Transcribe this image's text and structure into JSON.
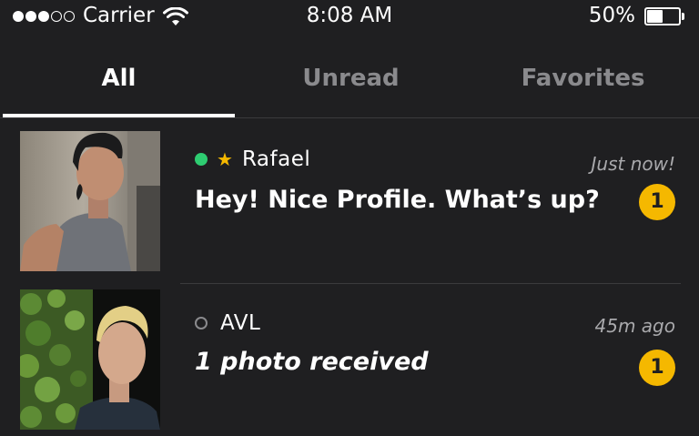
{
  "status_bar": {
    "carrier": "Carrier",
    "time": "8:08 AM",
    "battery_percent": "50%",
    "battery_level": 0.5,
    "signal_bars_filled": 3,
    "signal_bars_total": 5
  },
  "tabs": [
    {
      "label": "All",
      "active": true
    },
    {
      "label": "Unread",
      "active": false
    },
    {
      "label": "Favorites",
      "active": false
    }
  ],
  "conversations": [
    {
      "name": "Rafael",
      "online": true,
      "favorite": true,
      "timestamp": "Just now!",
      "message": "Hey! Nice Profile. What’s up?",
      "unread_count": "1"
    },
    {
      "name": "AVL",
      "online": false,
      "favorite": false,
      "timestamp": "45m ago",
      "message": "1 photo received",
      "unread_count": "1"
    }
  ],
  "colors": {
    "background": "#1f1f21",
    "accent": "#f5b800",
    "online": "#2ecc71",
    "inactive_text": "#8a8a8d"
  }
}
